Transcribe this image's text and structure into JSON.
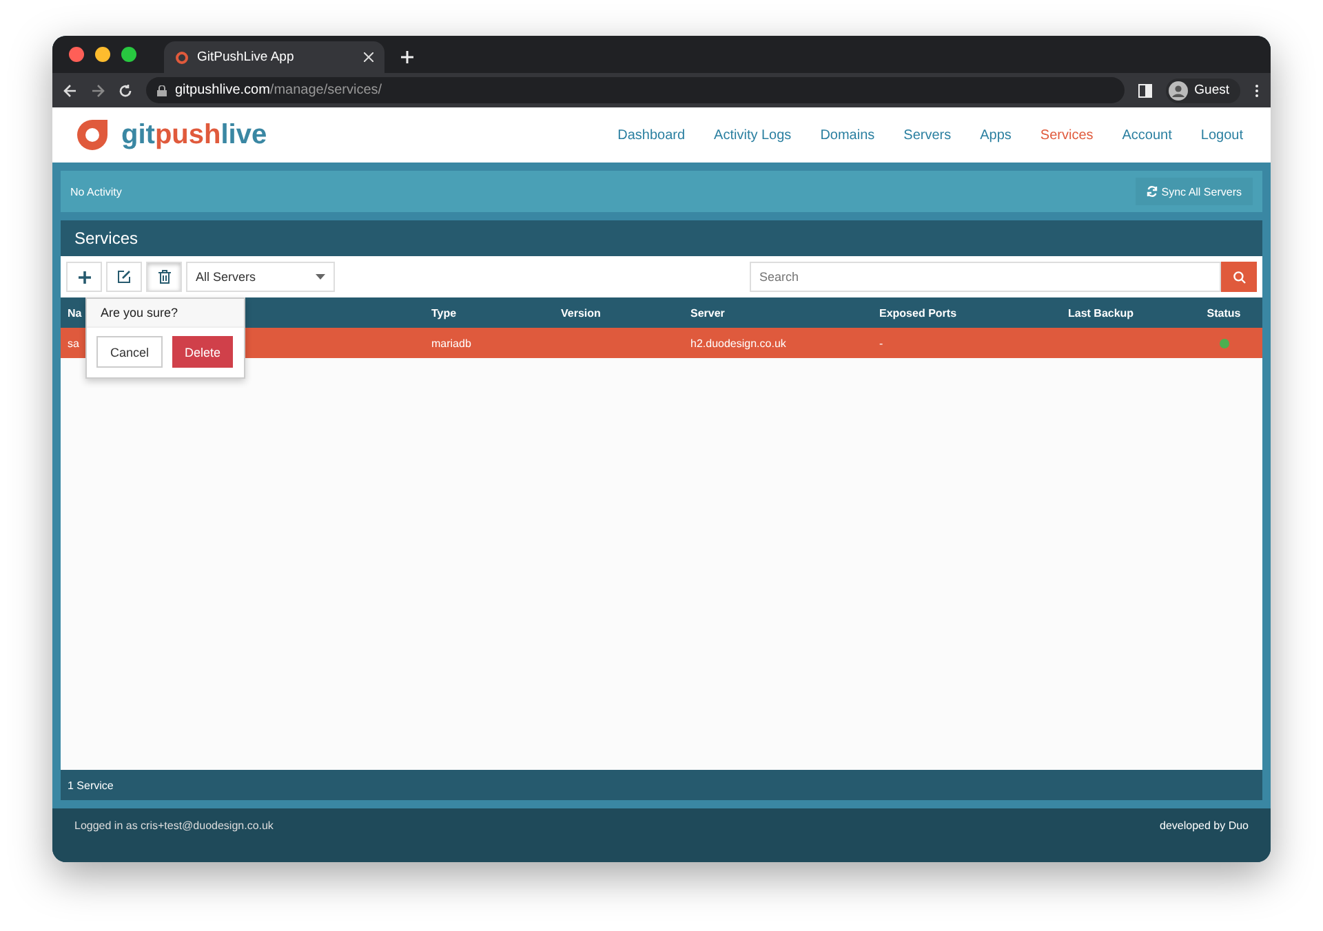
{
  "browser": {
    "tab_title": "GitPushLive App",
    "url_host": "gitpushlive.com",
    "url_path": "/manage/services/",
    "profile": "Guest"
  },
  "brand": {
    "part1": "git",
    "part2": "push",
    "part3": "live"
  },
  "nav": [
    {
      "label": "Dashboard",
      "selected": false
    },
    {
      "label": "Activity Logs",
      "selected": false
    },
    {
      "label": "Domains",
      "selected": false
    },
    {
      "label": "Servers",
      "selected": false
    },
    {
      "label": "Apps",
      "selected": false
    },
    {
      "label": "Services",
      "selected": true
    },
    {
      "label": "Account",
      "selected": false
    },
    {
      "label": "Logout",
      "selected": false
    }
  ],
  "activity": {
    "text": "No Activity",
    "button": "Sync All Servers"
  },
  "panel": {
    "title": "Services",
    "filter": "All Servers",
    "search_placeholder": "Search"
  },
  "table": {
    "columns": [
      "Na",
      "Type",
      "Version",
      "Server",
      "Exposed Ports",
      "Last Backup",
      "Status"
    ],
    "rows": [
      {
        "name": "sa",
        "type": "mariadb",
        "version": "",
        "server": "h2.duodesign.co.uk",
        "ports": "-",
        "backup": "",
        "color": "#4caf50",
        "selected": true
      }
    ]
  },
  "confirm": {
    "question": "Are you sure?",
    "cancel": "Cancel",
    "delete": "Delete"
  },
  "count": "1 Service",
  "footer": {
    "left": "Logged in as cris+test@duodesign.co.uk",
    "right": "developed by Duo"
  }
}
